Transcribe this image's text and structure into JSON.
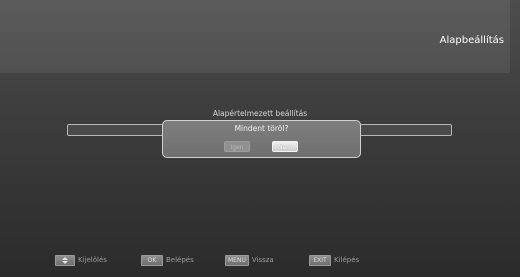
{
  "screen": {
    "title": "Alapbeállítás"
  },
  "setting": {
    "label": "Alapértelmezett beállítás"
  },
  "dialog": {
    "message": "Mindent töröl?",
    "yes_label": "Igen",
    "no_label": "Nem"
  },
  "hints": {
    "select": {
      "key": "",
      "icon": "up-down-arrows-icon",
      "label": "Kijelölés"
    },
    "ok": {
      "key": "OK",
      "label": "Belépés"
    },
    "menu": {
      "key": "MENU",
      "label": "Vissza"
    },
    "exit": {
      "key": "EXIT",
      "label": "Kilépés"
    }
  },
  "colors": {
    "background": "#3c3c3c",
    "dialog_background": "#737373",
    "selected_button": "#dcdcdc",
    "title_text": "#ffffff"
  }
}
